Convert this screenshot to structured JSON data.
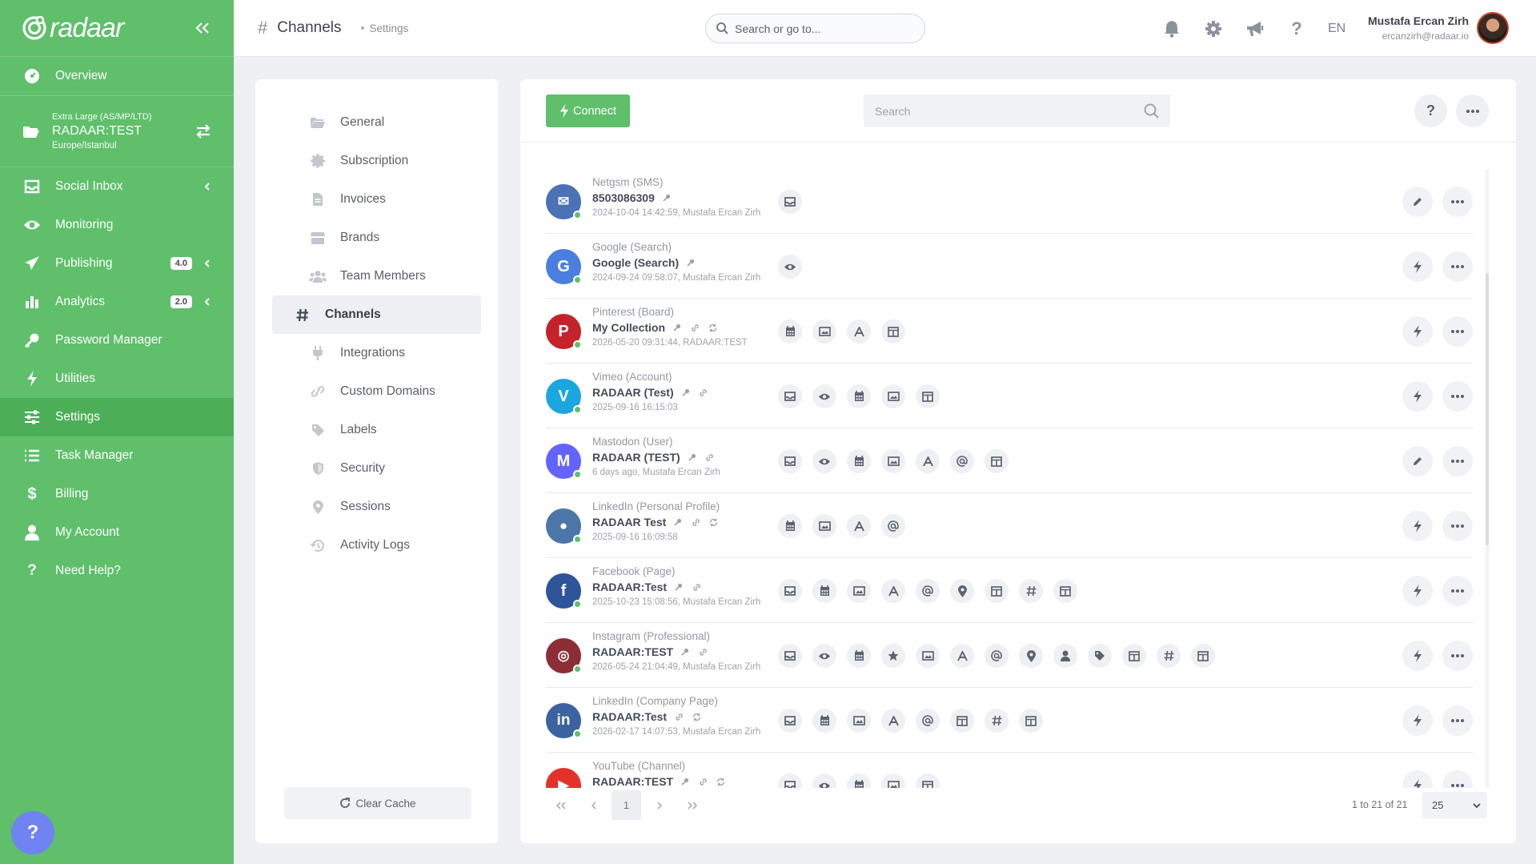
{
  "app": {
    "logo_text": "radaar"
  },
  "sidebar": {
    "items": [
      {
        "label": "Overview",
        "icon": "gauge-icon"
      },
      {
        "label": "Social Inbox",
        "icon": "inbox-icon"
      },
      {
        "label": "Monitoring",
        "icon": "eye-icon"
      },
      {
        "label": "Publishing",
        "icon": "paper-plane-icon",
        "badge": "4.0"
      },
      {
        "label": "Analytics",
        "icon": "bar-chart-icon",
        "badge": "2.0"
      },
      {
        "label": "Password Manager",
        "icon": "key-icon"
      },
      {
        "label": "Utilities",
        "icon": "bolt-icon"
      },
      {
        "label": "Settings",
        "icon": "sliders-icon"
      },
      {
        "label": "Task Manager",
        "icon": "list-icon"
      },
      {
        "label": "Billing",
        "icon": "dollar-icon"
      },
      {
        "label": "My Account",
        "icon": "user-icon"
      },
      {
        "label": "Need Help?",
        "icon": "question-icon"
      }
    ],
    "workspace": {
      "plan": "Extra Large (AS/MP/LTD)",
      "name": "RADAAR:TEST",
      "timezone": "Europe/Istanbul"
    },
    "help_fab": "?"
  },
  "topbar": {
    "title": "Channels",
    "breadcrumb": "Settings",
    "search_placeholder": "Search or go to...",
    "lang": "EN",
    "user_name": "Mustafa Ercan Zirh",
    "user_email": "ercanzirh@radaar.io"
  },
  "settings_menu": {
    "items": [
      {
        "label": "General",
        "icon": "folder-open-icon"
      },
      {
        "label": "Subscription",
        "icon": "certificate-icon"
      },
      {
        "label": "Invoices",
        "icon": "file-icon"
      },
      {
        "label": "Brands",
        "icon": "store-icon"
      },
      {
        "label": "Team Members",
        "icon": "users-icon"
      },
      {
        "label": "Channels",
        "icon": "hash-icon"
      },
      {
        "label": "Integrations",
        "icon": "plug-icon"
      },
      {
        "label": "Custom Domains",
        "icon": "link-icon"
      },
      {
        "label": "Labels",
        "icon": "tag-icon"
      },
      {
        "label": "Security",
        "icon": "shield-icon"
      },
      {
        "label": "Sessions",
        "icon": "map-pin-icon"
      },
      {
        "label": "Activity Logs",
        "icon": "history-icon"
      }
    ],
    "clear_cache": "Clear Cache"
  },
  "channels": {
    "connect_label": "Connect",
    "search_placeholder": "Search",
    "rows": [
      {
        "type": "Netgsm (SMS)",
        "name": "8503086309",
        "meta": "2024-10-04 14:42:59, Mustafa Ercan Zirh",
        "color": "#4a72b5",
        "icon": "sms-icon",
        "glyph": "✉",
        "minis": [
          "key"
        ],
        "caps": [
          "inbox"
        ],
        "action": "edit"
      },
      {
        "type": "Google (Search)",
        "name": "Google (Search)",
        "meta": "2024-09-24 09:58:07, Mustafa Ercan Zirh",
        "color": "#4a7fe0",
        "icon": "google-icon",
        "glyph": "G",
        "minis": [
          "key"
        ],
        "caps": [
          "eye"
        ],
        "action": "bolt"
      },
      {
        "type": "Pinterest (Board)",
        "name": "My Collection",
        "meta": "2026-05-20 09:31:44, RADAAR:TEST",
        "color": "#c4232b",
        "icon": "pinterest-icon",
        "glyph": "P",
        "minis": [
          "key",
          "link",
          "sync"
        ],
        "caps": [
          "calendar",
          "image",
          "text",
          "layout"
        ],
        "action": "bolt"
      },
      {
        "type": "Vimeo (Account)",
        "name": "RADAAR (Test)",
        "meta": "2025-09-16 16:15:03",
        "color": "#1ca6e0",
        "icon": "vimeo-icon",
        "glyph": "V",
        "minis": [
          "key",
          "link"
        ],
        "caps": [
          "inbox",
          "eye",
          "calendar",
          "image",
          "layout"
        ],
        "action": "bolt"
      },
      {
        "type": "Mastodon (User)",
        "name": "RADAAR (TEST)",
        "meta": "6 days ago, Mustafa Ercan Zirh",
        "color": "#6563ff",
        "icon": "mastodon-icon",
        "glyph": "M",
        "minis": [
          "key",
          "link"
        ],
        "caps": [
          "inbox",
          "eye",
          "calendar",
          "image",
          "text",
          "at",
          "layout"
        ],
        "action": "edit"
      },
      {
        "type": "LinkedIn (Personal Profile)",
        "name": "RADAAR Test",
        "meta": "2025-09-16 16:09:58",
        "color": "#4c76a8",
        "icon": "user-icon",
        "glyph": "●",
        "minis": [
          "key",
          "link",
          "sync"
        ],
        "caps": [
          "calendar",
          "image",
          "text",
          "at"
        ],
        "action": "bolt"
      },
      {
        "type": "Facebook (Page)",
        "name": "RADAAR:Test",
        "meta": "2025-10-23 15:08:56, Mustafa Ercan Zirh",
        "color": "#2e5499",
        "icon": "facebook-icon",
        "glyph": "f",
        "minis": [
          "key",
          "link"
        ],
        "caps": [
          "inbox",
          "calendar",
          "image",
          "text",
          "at",
          "pin",
          "layout",
          "hash",
          "layout"
        ],
        "action": "bolt"
      },
      {
        "type": "Instagram (Professional)",
        "name": "RADAAR:TEST",
        "meta": "2026-05-24 21:04:49, Mustafa Ercan Zirh",
        "color": "#8c2e36",
        "icon": "instagram-icon",
        "glyph": "◎",
        "minis": [
          "key",
          "link"
        ],
        "caps": [
          "inbox",
          "eye",
          "calendar",
          "star",
          "image",
          "text",
          "at",
          "pin",
          "user",
          "tag",
          "layout",
          "hash",
          "layout"
        ],
        "action": "bolt"
      },
      {
        "type": "LinkedIn (Company Page)",
        "name": "RADAAR:Test",
        "meta": "2026-02-17 14:07:53, Mustafa Ercan Zirh",
        "color": "#3c63a0",
        "icon": "linkedin-icon",
        "glyph": "in",
        "minis": [
          "link",
          "sync"
        ],
        "caps": [
          "inbox",
          "calendar",
          "image",
          "text",
          "at",
          "layout",
          "hash",
          "layout"
        ],
        "action": "bolt"
      },
      {
        "type": "YouTube (Channel)",
        "name": "RADAAR:TEST",
        "meta": "",
        "color": "#e4322b",
        "icon": "youtube-icon",
        "glyph": "▶",
        "minis": [
          "key",
          "link",
          "sync"
        ],
        "caps": [
          "inbox",
          "eye",
          "calendar",
          "image",
          "layout"
        ],
        "action": "bolt"
      }
    ]
  },
  "pagination": {
    "current": "1",
    "info": "1 to 21 of 21",
    "page_size": "25"
  },
  "colors": {
    "brand_green": "#5fbf6b",
    "sidebar_active": "#4caf58",
    "help_fab": "#6f83f2"
  }
}
